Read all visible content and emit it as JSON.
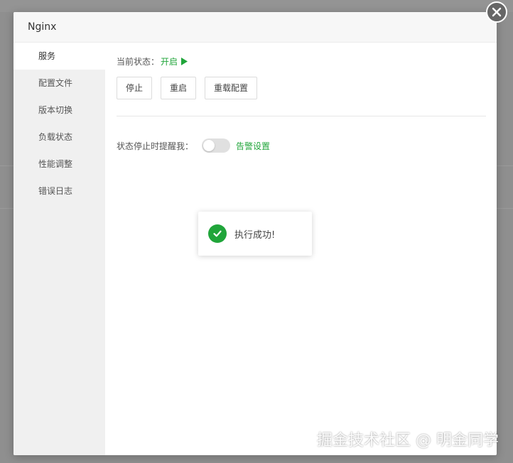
{
  "modal": {
    "title": "Nginx"
  },
  "sidebar": {
    "items": [
      {
        "label": "服务",
        "active": true
      },
      {
        "label": "配置文件",
        "active": false
      },
      {
        "label": "版本切换",
        "active": false
      },
      {
        "label": "负载状态",
        "active": false
      },
      {
        "label": "性能调整",
        "active": false
      },
      {
        "label": "错误日志",
        "active": false
      }
    ]
  },
  "service": {
    "status_label": "当前状态：",
    "status_value": "开启",
    "status_icon": "play-icon",
    "buttons": {
      "stop": "停止",
      "restart": "重启",
      "reload": "重载配置"
    },
    "alert_label": "状态停止时提醒我：",
    "alert_toggle_on": false,
    "alert_link": "告警设置"
  },
  "toast": {
    "icon": "check-circle-icon",
    "message": "执行成功!"
  },
  "watermark": "掘金技术社区 @ 明金同学",
  "colors": {
    "accent": "#20a53a",
    "overlay": "#8f8f8f",
    "close_button": "#666666"
  }
}
